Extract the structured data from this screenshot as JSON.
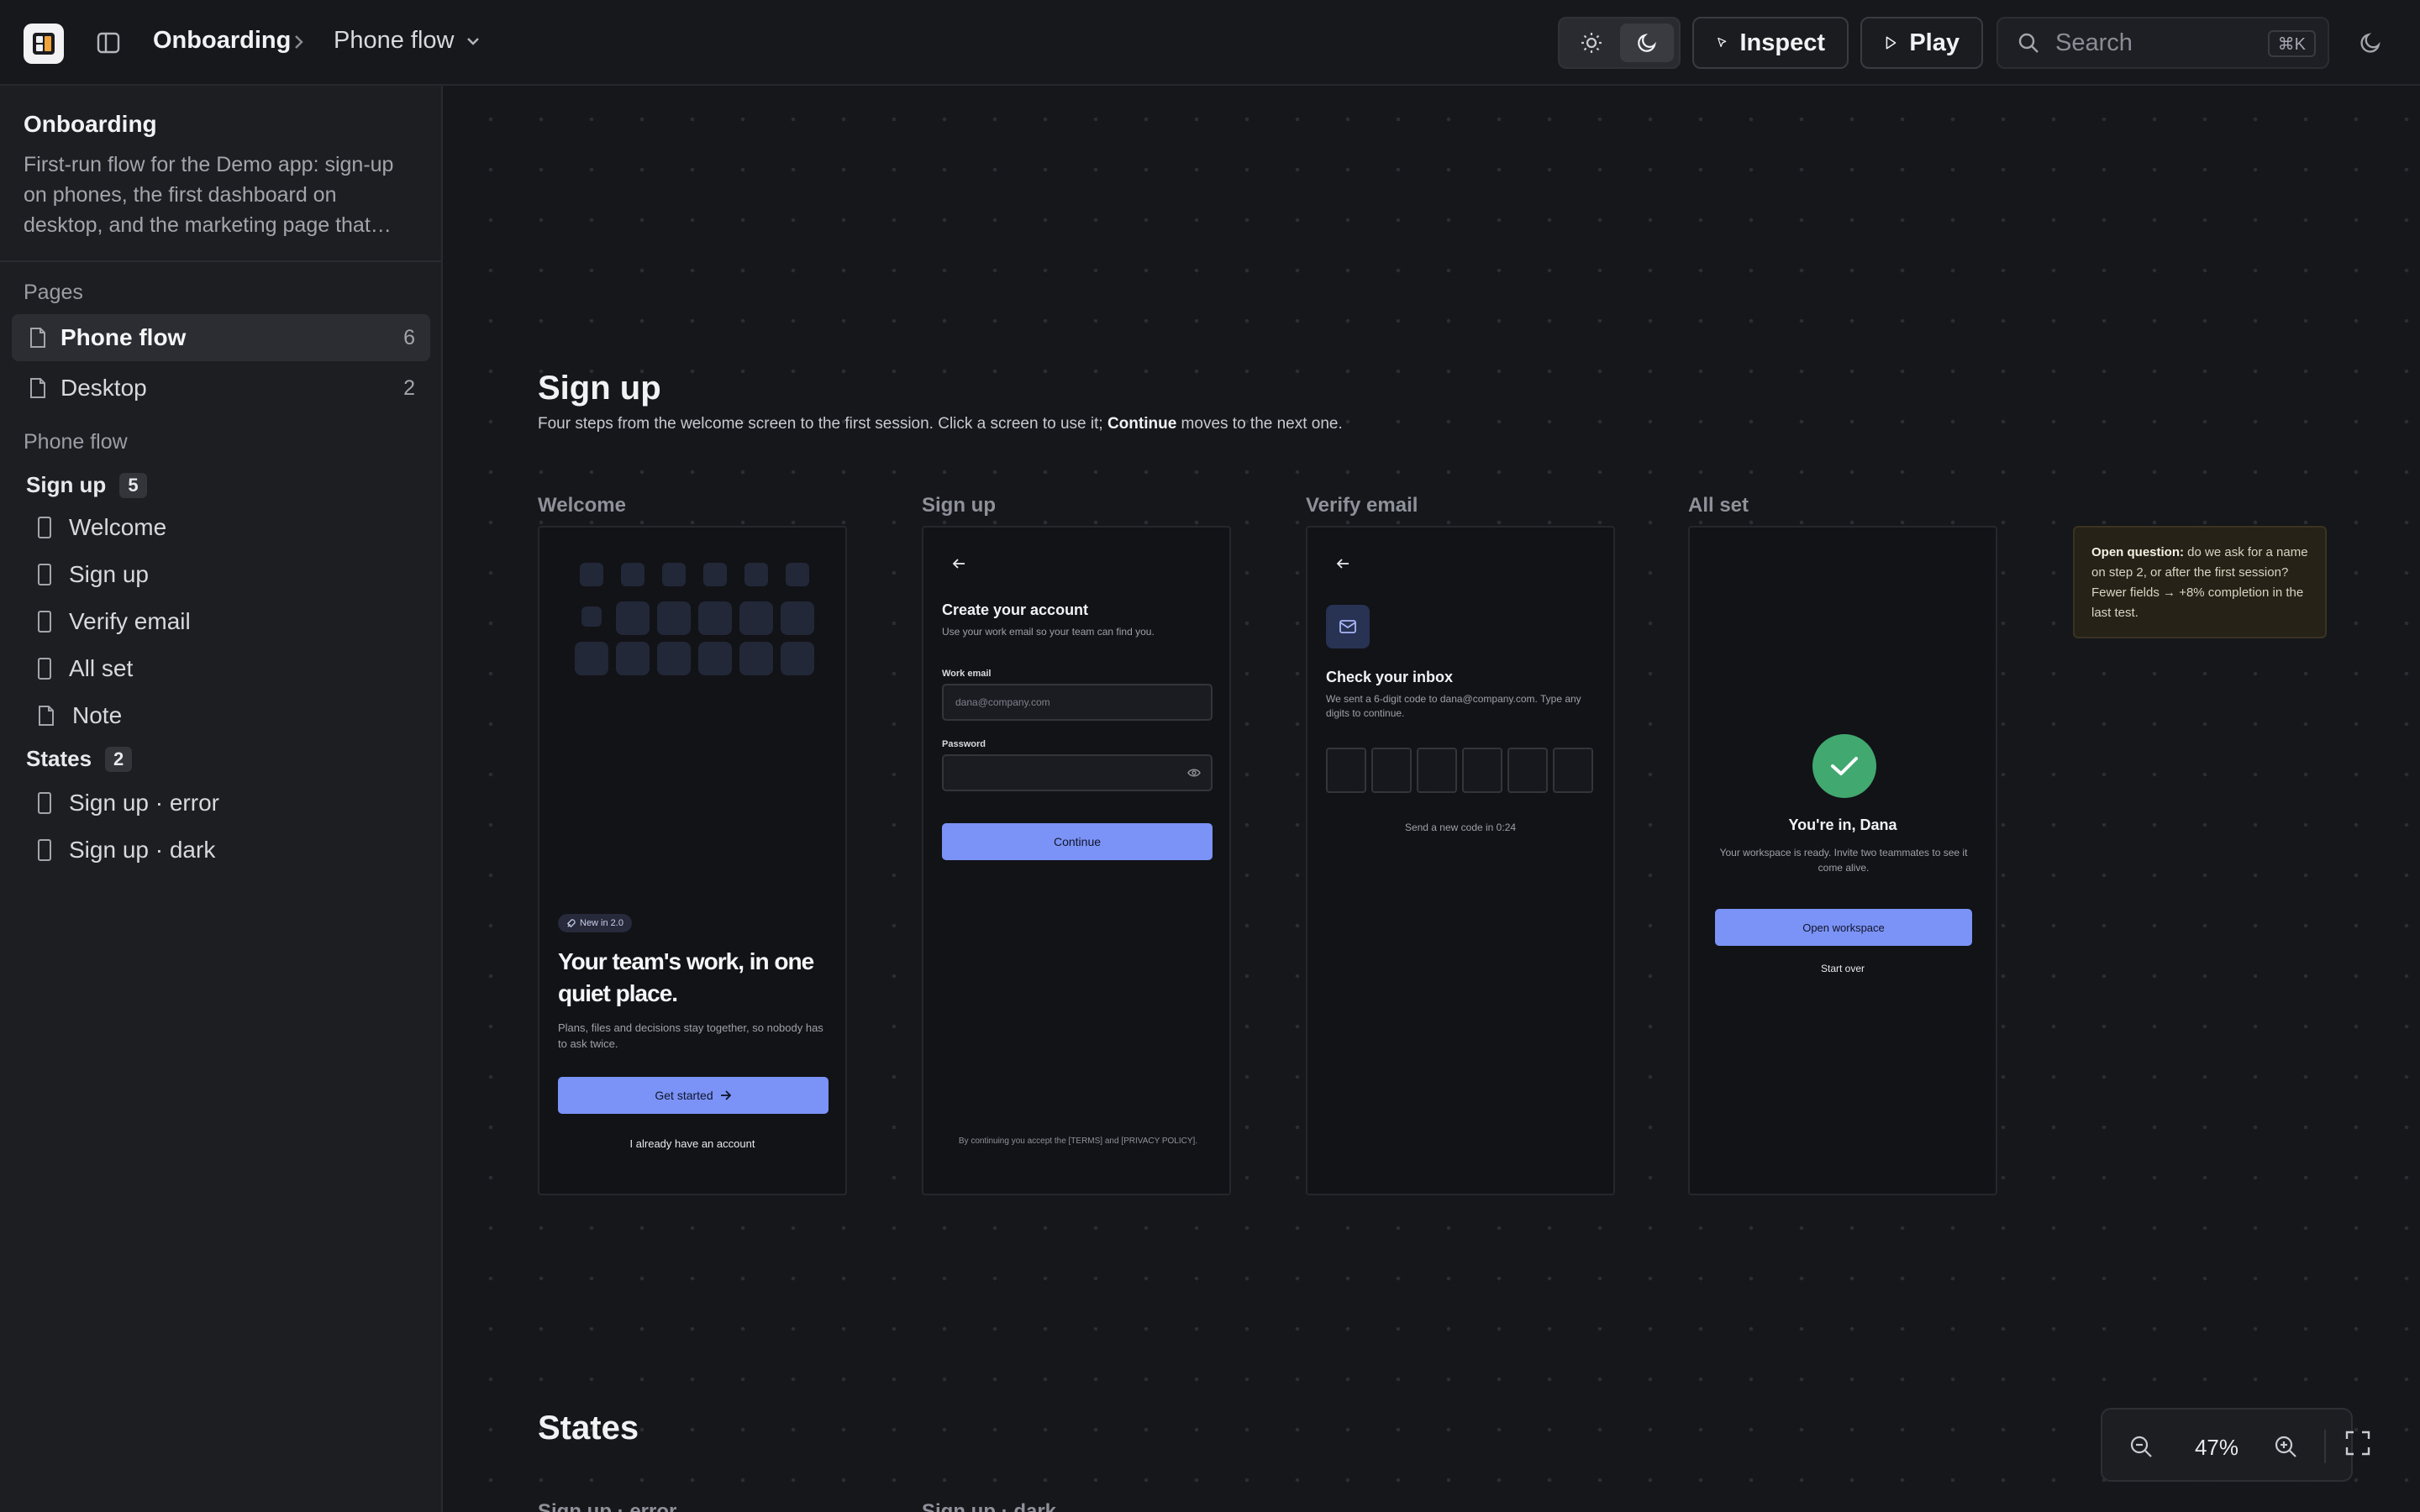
{
  "header": {
    "project": "Onboarding",
    "page": "Phone flow",
    "inspect_label": "Inspect",
    "play_label": "Play",
    "search_placeholder": "Search",
    "search_shortcut": "⌘K"
  },
  "sidebar": {
    "project_title": "Onboarding",
    "project_description": "First-run flow for the Demo app: sign-up on phones, the first dashboard on desktop, and the marketing page that…",
    "pages_label": "Pages",
    "pages": [
      {
        "label": "Phone flow",
        "count": "6",
        "active": true
      },
      {
        "label": "Desktop",
        "count": "2",
        "active": false
      }
    ],
    "current_page_label": "Phone flow",
    "groups": [
      {
        "label": "Sign up",
        "count": "5",
        "items": [
          "Welcome",
          "Sign up",
          "Verify email",
          "All set",
          "Note"
        ]
      },
      {
        "label": "States",
        "count": "2",
        "items": [
          "Sign up · error",
          "Sign up · dark"
        ]
      }
    ]
  },
  "canvas": {
    "signup_section": {
      "title": "Sign up",
      "subtitle_pre": "Four steps from the welcome screen to the first session. Click a screen to use it; ",
      "subtitle_bold": "Continue",
      "subtitle_post": " moves to the next one."
    },
    "frames": {
      "welcome": {
        "label": "Welcome",
        "badge": "New in 2.0",
        "title": "Your team's work, in one quiet place.",
        "description": "Plans, files and decisions stay together, so nobody has to ask twice.",
        "cta": "Get started",
        "secondary": "I already have an account"
      },
      "signup": {
        "label": "Sign up",
        "title": "Create your account",
        "description": "Use your work email so your team can find you.",
        "email_label": "Work email",
        "email_placeholder": "dana@company.com",
        "password_label": "Password",
        "cta": "Continue",
        "legal": "By continuing you accept the [TERMS] and [PRIVACY POLICY]."
      },
      "verify": {
        "label": "Verify email",
        "title": "Check your inbox",
        "description": "We sent a 6-digit code to dana@company.com. Type any digits to continue.",
        "resend": "Send a new code in 0:24"
      },
      "allset": {
        "label": "All set",
        "title": "You're in, Dana",
        "description": "Your workspace is ready. Invite two teammates to see it come alive.",
        "cta": "Open workspace",
        "secondary": "Start over"
      }
    },
    "note": {
      "bold": "Open question:",
      "text": " do we ask for a name on step 2, or after the first session? Fewer fields → +8% completion in the last test."
    },
    "states_section": {
      "title": "States",
      "frame_labels": [
        "Sign up · error",
        "Sign up · dark"
      ]
    }
  },
  "zoom": {
    "value": "47%"
  },
  "colors": {
    "accent": "#7b93f7",
    "success": "#41a86f",
    "note_bg": "#262218"
  }
}
